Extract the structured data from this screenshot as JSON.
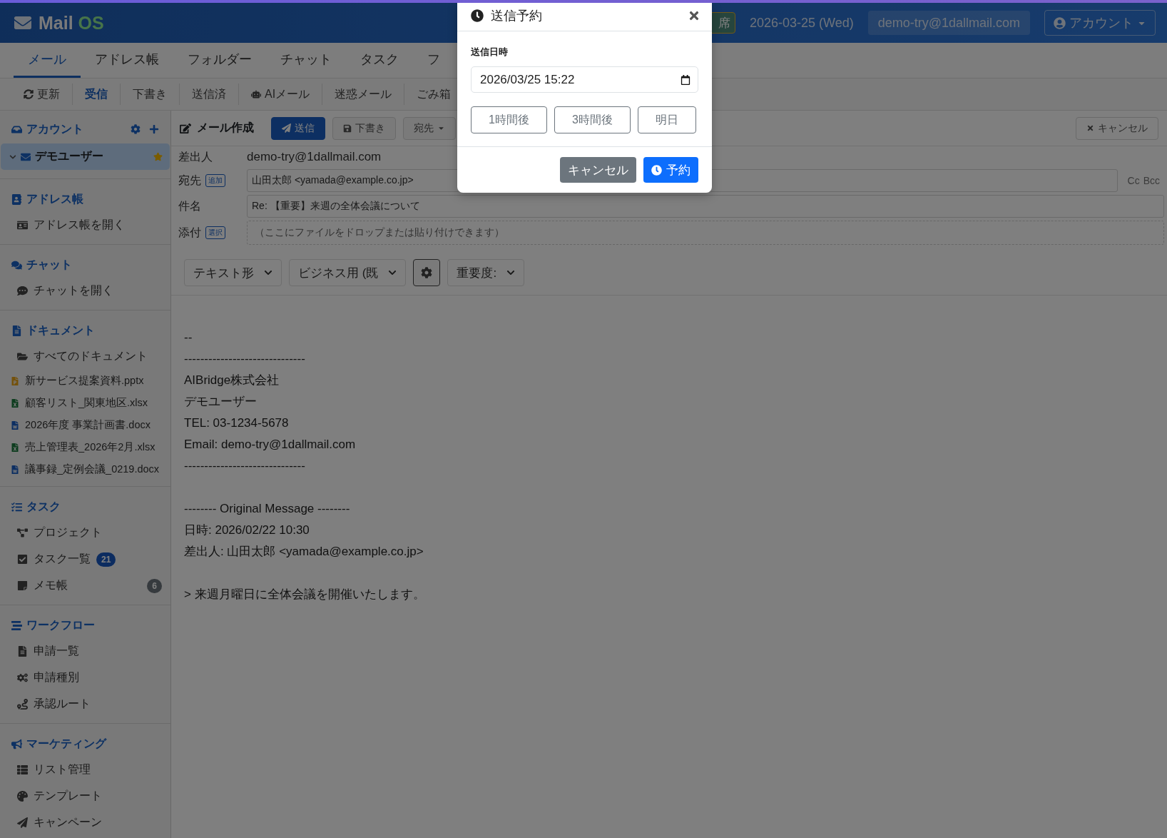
{
  "topbar": {
    "logo": {
      "word1": "Mail",
      "word2": "OS"
    },
    "status_chip": "席",
    "date": "2026-03-25 (Wed)",
    "email": "demo-try@1dallmail.com",
    "account_button": "アカウント"
  },
  "nav_tabs": [
    {
      "label": "メール",
      "selected": true
    },
    {
      "label": "アドレス帳",
      "selected": false
    },
    {
      "label": "フォルダー",
      "selected": false
    },
    {
      "label": "チャット",
      "selected": false
    },
    {
      "label": "タスク",
      "selected": false
    },
    {
      "label": "フ",
      "selected": false
    }
  ],
  "mail_toolbar": [
    {
      "label": "更新",
      "selected": false
    },
    {
      "label": "受信",
      "selected": true
    },
    {
      "label": "下書き",
      "selected": false
    },
    {
      "label": "送信済",
      "selected": false
    },
    {
      "label": "AIメール",
      "selected": false
    },
    {
      "label": "迷惑メール",
      "selected": false
    },
    {
      "label": "ごみ箱",
      "selected": false
    }
  ],
  "sidebar": {
    "account_section": {
      "title": "アカウント",
      "accounts": [
        {
          "name": "デモユーザー",
          "selected": true,
          "expanded": true,
          "starred": true
        }
      ]
    },
    "sections": [
      {
        "title": "アドレス帳",
        "items": [
          {
            "label": "アドレス帳を開く",
            "kind": "link"
          }
        ]
      },
      {
        "title": "チャット",
        "items": [
          {
            "label": "チャットを開く",
            "kind": "link"
          }
        ]
      },
      {
        "title": "ドキュメント",
        "items": [
          {
            "label": "すべてのドキュメント",
            "kind": "link"
          },
          {
            "label": "新サービス提案資料.pptx",
            "kind": "pptx"
          },
          {
            "label": "顧客リスト_関東地区.xlsx",
            "kind": "xlsx"
          },
          {
            "label": "2026年度 事業計画書.docx",
            "kind": "docx"
          },
          {
            "label": "売上管理表_2026年2月.xlsx",
            "kind": "xlsx"
          },
          {
            "label": "議事録_定例会議_0219.docx",
            "kind": "docx"
          }
        ]
      },
      {
        "title": "タスク",
        "items": [
          {
            "label": "プロジェクト",
            "kind": "link"
          },
          {
            "label": "タスク一覧",
            "kind": "link",
            "badge": {
              "text": "21",
              "kind": "inline"
            }
          },
          {
            "label": "メモ帳",
            "kind": "link",
            "badge": {
              "text": "6",
              "kind": "end"
            }
          }
        ]
      },
      {
        "title": "ワークフロー",
        "items": [
          {
            "label": "申請一覧",
            "kind": "link"
          },
          {
            "label": "申請種別",
            "kind": "link"
          },
          {
            "label": "承認ルート",
            "kind": "link"
          }
        ]
      },
      {
        "title": "マーケティング",
        "items": [
          {
            "label": "リスト管理",
            "kind": "link"
          },
          {
            "label": "テンプレート",
            "kind": "link"
          },
          {
            "label": "キャンペーン",
            "kind": "link"
          }
        ]
      }
    ]
  },
  "compose": {
    "title": "メール作成",
    "send_button": "送信",
    "draft_button": "下書き",
    "to_menu": "宛先",
    "cancel_button": "キャンセル",
    "fields": [
      {
        "label": "差出人",
        "kind": "text",
        "value": "demo-try@1dallmail.com"
      },
      {
        "label": "宛先",
        "kind": "input",
        "tag": "追加",
        "value": "山田太郎 <yamada@example.co.jp>",
        "extras": [
          "Cc",
          "Bcc"
        ]
      },
      {
        "label": "件名",
        "kind": "input",
        "value": "Re: 【重要】来週の全体会議について"
      },
      {
        "label": "添付",
        "kind": "dropzone",
        "tag": "選択",
        "placeholder": "（ここにファイルをドロップまたは貼り付けできます）"
      }
    ],
    "format_controls": [
      {
        "kind": "select",
        "label": "テキスト形"
      },
      {
        "kind": "select",
        "label": "ビジネス用 (既"
      },
      {
        "kind": "gear"
      },
      {
        "kind": "select",
        "label": "重要度:"
      }
    ],
    "body_paragraphs": [
      {
        "lines": [
          "--",
          "------------------------------",
          "AIBridge株式会社",
          "デモユーザー",
          "TEL: 03-1234-5678",
          "Email: demo-try@1dallmail.com",
          "------------------------------"
        ]
      },
      {
        "lines": [
          "-------- Original Message --------",
          "日時: 2026/02/22 10:30",
          "差出人: 山田太郎 <yamada@example.co.jp>"
        ]
      },
      {
        "lines": [
          "> 来週月曜日に全体会議を開催いたします。"
        ]
      }
    ]
  },
  "dialog": {
    "title": "送信予約",
    "field_label": "送信日時",
    "datetime": "2026/03/25 15:22",
    "quick_buttons": [
      "1時間後",
      "3時間後",
      "明日"
    ],
    "cancel_button": "キャンセル",
    "confirm_button": "予約"
  }
}
